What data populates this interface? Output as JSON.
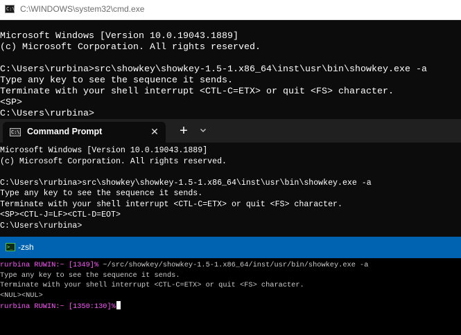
{
  "cmd_window": {
    "title": "C:\\WINDOWS\\system32\\cmd.exe",
    "icon": "cmd-icon",
    "lines": [
      "Microsoft Windows [Version 10.0.19043.1889]",
      "(c) Microsoft Corporation. All rights reserved.",
      "",
      "C:\\Users\\rurbina>src\\showkey\\showkey-1.5-1.x86_64\\inst\\usr\\bin\\showkey.exe -a",
      "Type any key to see the sequence it sends.",
      "Terminate with your shell interrupt <CTL-C=ETX> or quit <FS> character.",
      "<SP>",
      "C:\\Users\\rurbina>"
    ]
  },
  "terminal_window": {
    "tab_title": "Command Prompt",
    "close_glyph": "✕",
    "new_tab_glyph": "+",
    "icon": "cmd-icon",
    "lines": [
      "Microsoft Windows [Version 10.0.19043.1889]",
      "(c) Microsoft Corporation. All rights reserved.",
      "",
      "C:\\Users\\rurbina>src\\showkey\\showkey-1.5-1.x86_64\\inst\\usr\\bin\\showkey.exe -a",
      "Type any key to see the sequence it sends.",
      "Terminate with your shell interrupt <CTL-C=ETX> or quit <FS> character.",
      "<SP><CTL-J=LF><CTL-D=EOT>",
      "C:\\Users\\rurbina>"
    ]
  },
  "zsh_window": {
    "title": "-zsh",
    "icon": "mintty-icon",
    "prompt1": {
      "text": "rurbina RUWIN:~ [1349]%",
      "command": " ~/src/showkey/showkey-1.5-1.x86_64/inst/usr/bin/showkey.exe -a"
    },
    "output": [
      "Type any key to see the sequence it sends.",
      "Terminate with your shell interrupt <CTL-C=ETX> or quit <FS> character.",
      "<NUL><NUL>"
    ],
    "prompt2": {
      "text": "rurbina RUWIN:~ [1350:130]%"
    }
  },
  "colors": {
    "console_bg": "#0c0c0c",
    "console_fg": "#ffffff",
    "zsh_prompt": "#ff55ff",
    "zsh_titlebar": "#0063b1",
    "terminal_tabstrip": "#202020"
  }
}
